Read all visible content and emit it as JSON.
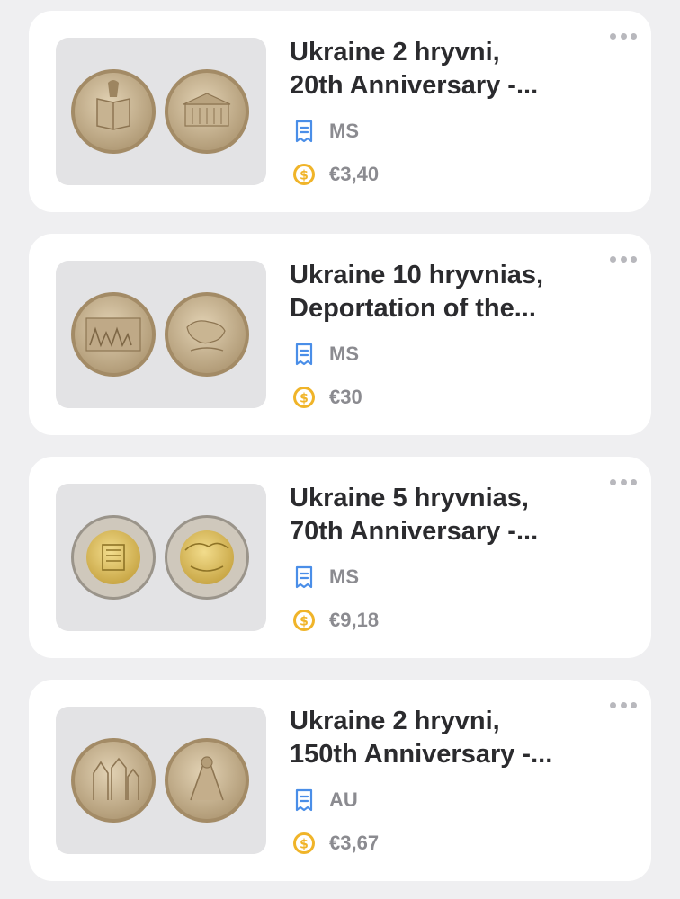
{
  "items": [
    {
      "title_line1": "Ukraine 2 hryvni,",
      "title_line2": "20th Anniversary -...",
      "grade": "MS",
      "price": "€3,40"
    },
    {
      "title_line1": "Ukraine 10 hryvnias,",
      "title_line2": "Deportation of the...",
      "grade": "MS",
      "price": "€30"
    },
    {
      "title_line1": "Ukraine 5 hryvnias,",
      "title_line2": "70th Anniversary -...",
      "grade": "MS",
      "price": "€9,18"
    },
    {
      "title_line1": "Ukraine 2 hryvni,",
      "title_line2": "150th Anniversary -...",
      "grade": "AU",
      "price": "€3,67"
    }
  ],
  "icons": {
    "grade": "receipt-icon",
    "price": "coin-dollar-icon",
    "more": "more-dots-icon"
  },
  "colors": {
    "background": "#efeff1",
    "card": "#ffffff",
    "title": "#2b2b2e",
    "meta_text": "#8b8b90",
    "grade_icon": "#4a8ee8",
    "price_icon": "#f0b429"
  }
}
